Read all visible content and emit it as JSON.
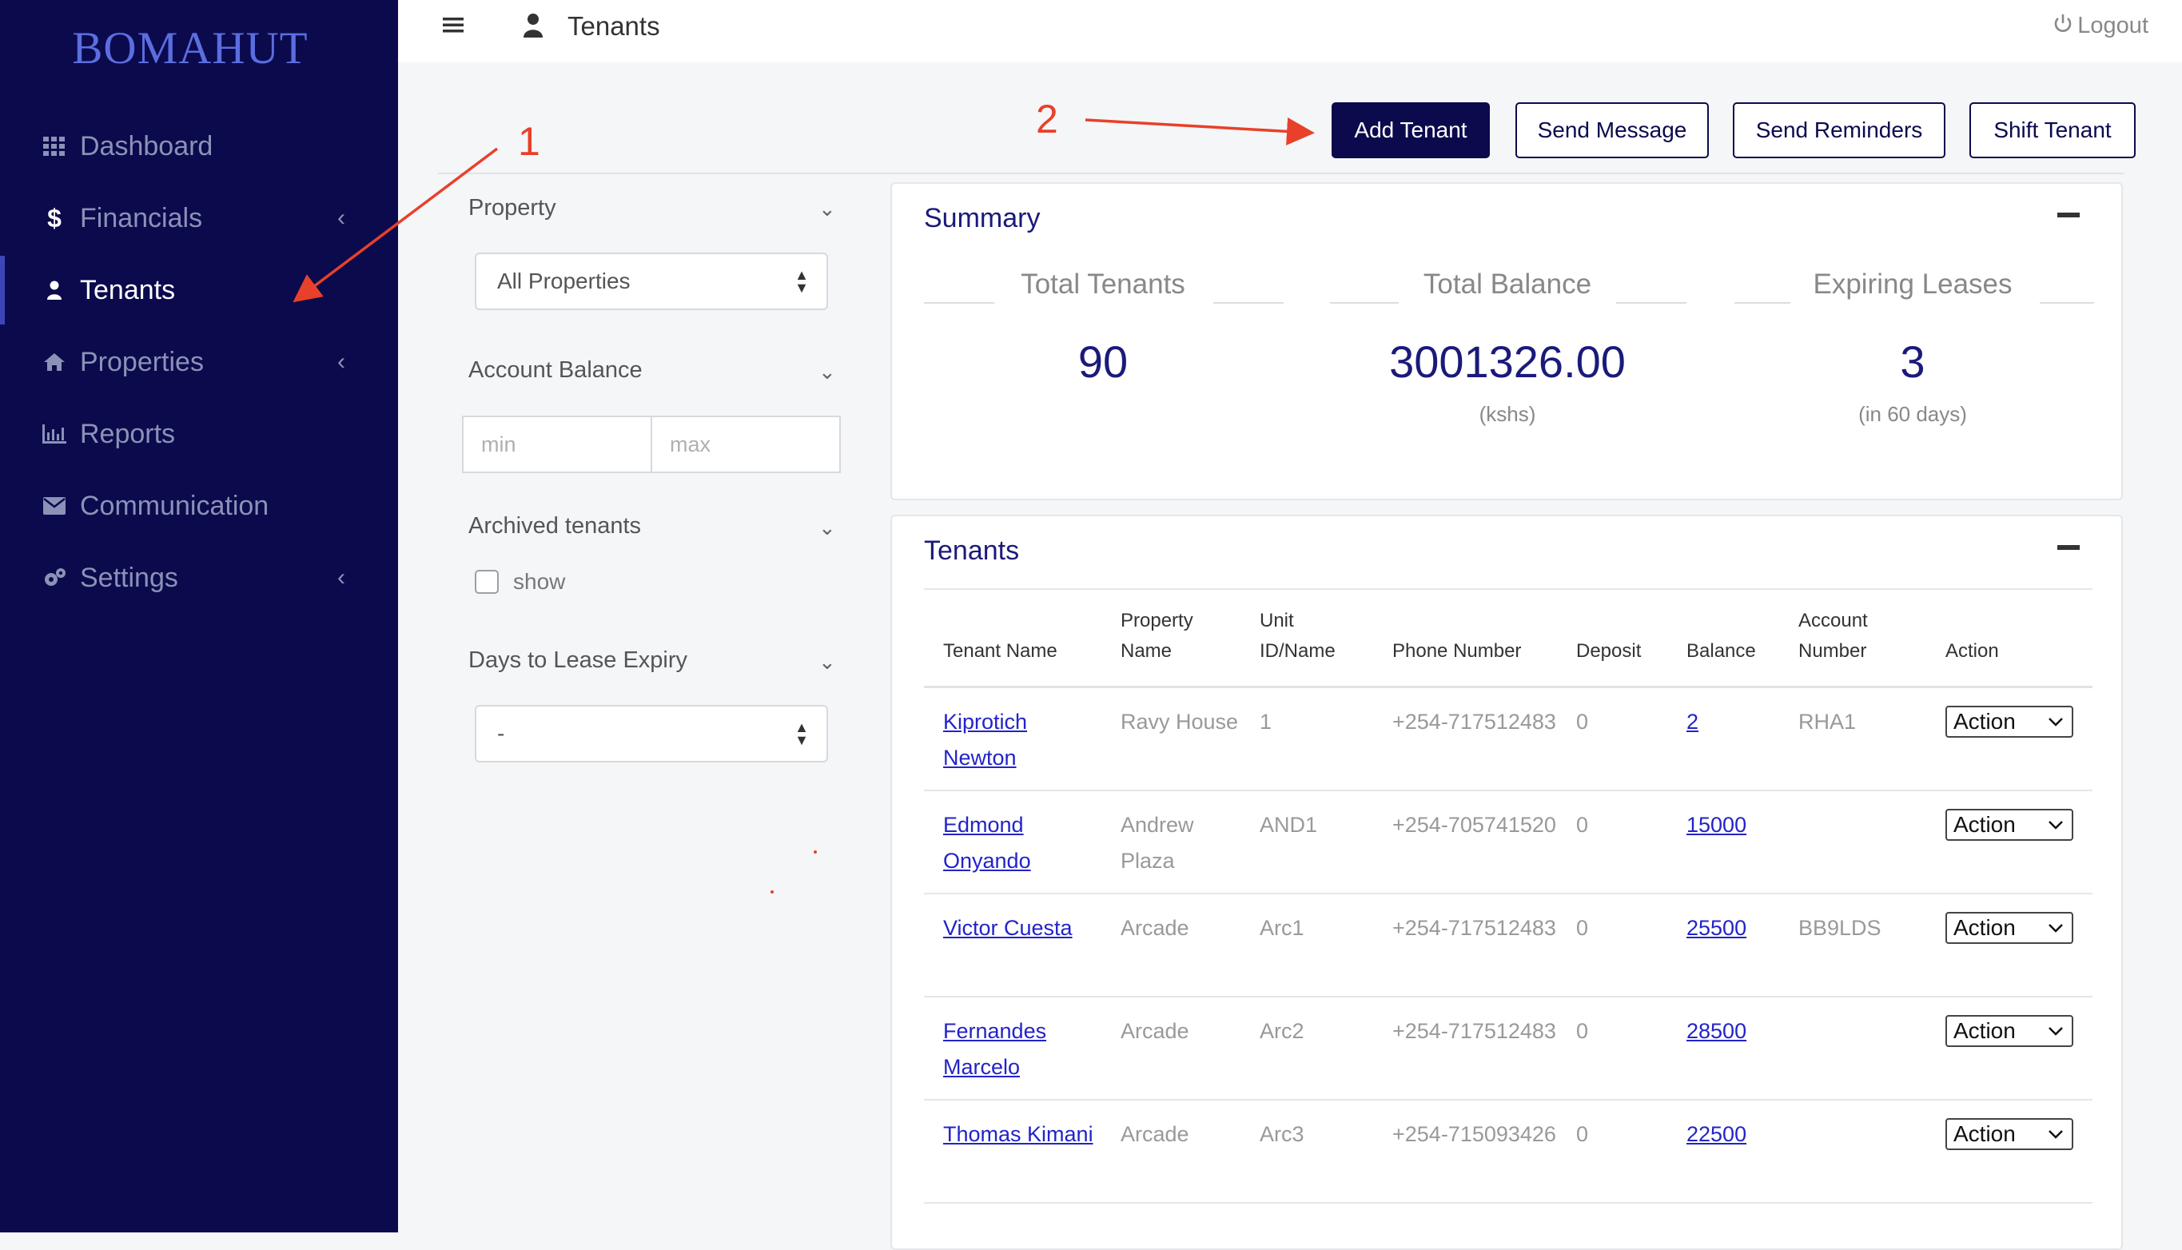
{
  "sidebar": {
    "brand": "BOMAHUT",
    "items": [
      {
        "label": "Dashboard",
        "icon": "grid-icon"
      },
      {
        "label": "Financials",
        "icon": "dollar-icon",
        "caret": "‹"
      },
      {
        "label": "Tenants",
        "icon": "user-icon",
        "active": true
      },
      {
        "label": "Properties",
        "icon": "home-icon",
        "caret": "‹"
      },
      {
        "label": "Reports",
        "icon": "bar-chart-icon"
      },
      {
        "label": "Communication",
        "icon": "envelope-icon"
      },
      {
        "label": "Settings",
        "icon": "gears-icon",
        "caret": "‹"
      }
    ]
  },
  "header": {
    "title": "Tenants",
    "logout_label": "Logout"
  },
  "actions": {
    "add_tenant": "Add Tenant",
    "send_message": "Send Message",
    "send_reminders": "Send Reminders",
    "shift_tenant": "Shift Tenant"
  },
  "filters": {
    "property_label": "Property",
    "property_value": "All Properties",
    "balance_label": "Account Balance",
    "min_placeholder": "min",
    "max_placeholder": "max",
    "archived_label": "Archived tenants",
    "show_label": "show",
    "expiry_label": "Days to Lease Expiry",
    "expiry_value": "-"
  },
  "summary": {
    "title": "Summary",
    "total_tenants_label": "Total Tenants",
    "total_tenants_value": "90",
    "total_balance_label": "Total Balance",
    "total_balance_value": "3001326.00",
    "total_balance_unit": "(kshs)",
    "expiring_label": "Expiring Leases",
    "expiring_value": "3",
    "expiring_sub": "(in 60 days)"
  },
  "tenants_table": {
    "title": "Tenants",
    "columns": [
      "Tenant Name",
      "Property Name",
      "Unit ID/Name",
      "Phone Number",
      "Deposit",
      "Balance",
      "Account Number",
      "Action"
    ],
    "action_label": "Action",
    "rows": [
      {
        "name": "Kiprotich Newton",
        "property": "Ravy House",
        "unit": "1",
        "phone": "+254-717512483",
        "deposit": "0",
        "balance": "2",
        "account": "RHA1"
      },
      {
        "name": "Edmond Onyando",
        "property": "Andrew Plaza",
        "unit": "AND1",
        "phone": "+254-705741520",
        "deposit": "0",
        "balance": "15000",
        "account": ""
      },
      {
        "name": "Victor Cuesta",
        "property": "Arcade",
        "unit": "Arc1",
        "phone": "+254-717512483",
        "deposit": "0",
        "balance": "25500",
        "account": "BB9LDS"
      },
      {
        "name": "Fernandes Marcelo",
        "property": "Arcade",
        "unit": "Arc2",
        "phone": "+254-717512483",
        "deposit": "0",
        "balance": "28500",
        "account": ""
      },
      {
        "name": "Thomas Kimani",
        "property": "Arcade",
        "unit": "Arc3",
        "phone": "+254-715093426",
        "deposit": "0",
        "balance": "22500",
        "account": ""
      }
    ]
  },
  "annotations": {
    "marker_1": "1",
    "marker_2": "2"
  },
  "colors": {
    "sidebar": "#0b0a4d",
    "accent": "#1b1a7a",
    "annotation": "#e8402a",
    "link": "#2323c8"
  }
}
